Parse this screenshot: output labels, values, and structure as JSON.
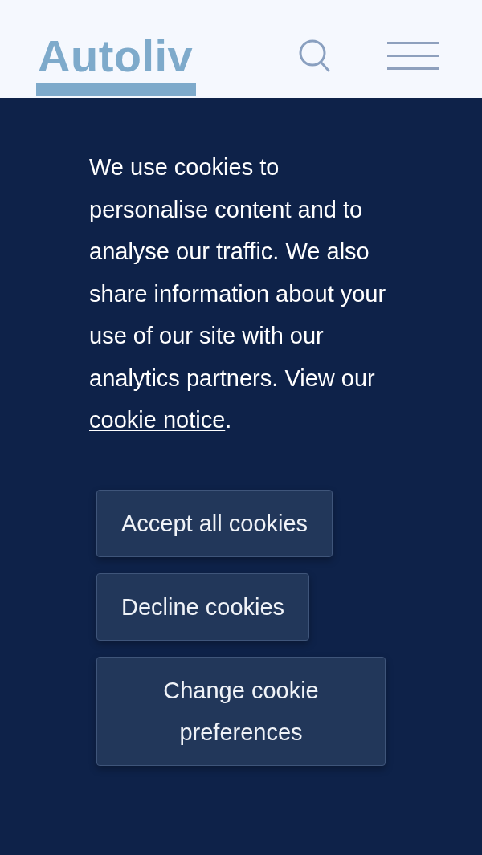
{
  "header": {
    "logo": "Autoliv"
  },
  "cookie_banner": {
    "message": "We use cookies to personalise content and to analyse our traffic. We also share information about your use of our site with our analytics partners. View our ",
    "link": "cookie notice",
    "after_link": ".",
    "buttons": [
      "Accept all cookies",
      "Decline cookies",
      "Change cookie preferences"
    ]
  }
}
